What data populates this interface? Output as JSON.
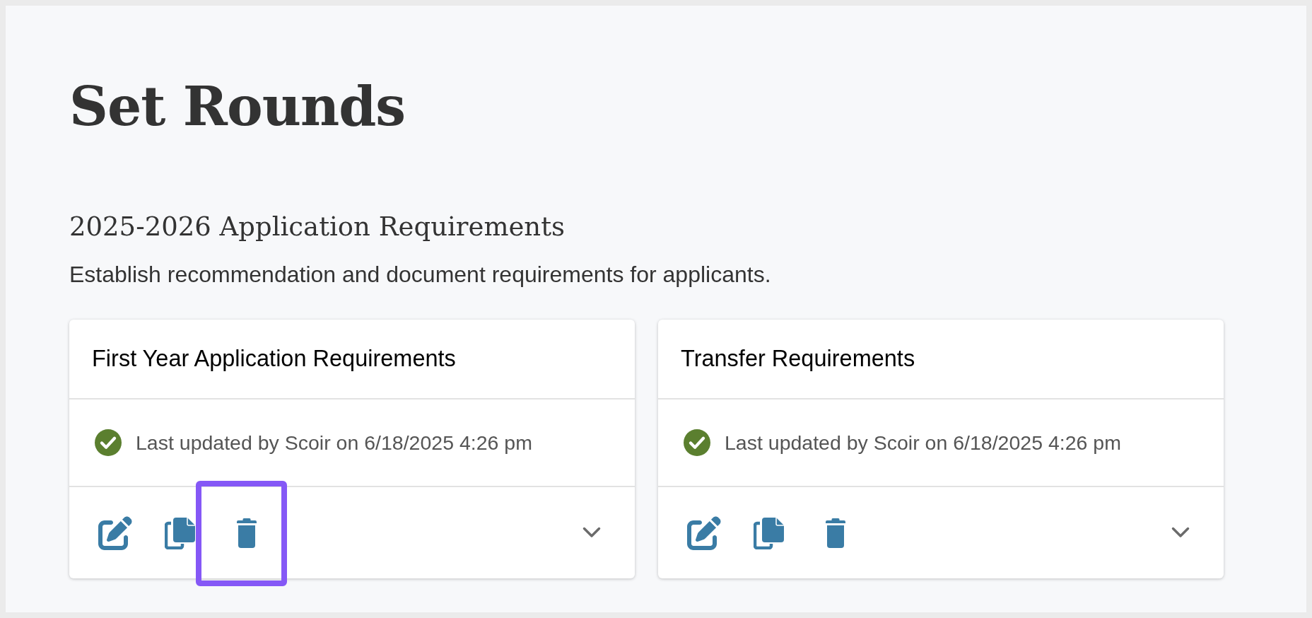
{
  "page": {
    "title": "Set Rounds"
  },
  "section": {
    "title": "2025-2026 Application Requirements",
    "description": "Establish recommendation and document requirements for applicants."
  },
  "cards": [
    {
      "title": "First Year Application Requirements",
      "complete": true,
      "updated": "Last updated by Scoir on 6/18/2025 4:26 pm",
      "expanded": false,
      "actions": [
        {
          "kind": "edit",
          "highlighted": false
        },
        {
          "kind": "copy",
          "highlighted": false
        },
        {
          "kind": "delete",
          "highlighted": true
        }
      ]
    },
    {
      "title": "Transfer Requirements",
      "complete": true,
      "updated": "Last updated by Scoir on 6/18/2025 4:26 pm",
      "expanded": false,
      "actions": [
        {
          "kind": "edit",
          "highlighted": false
        },
        {
          "kind": "copy",
          "highlighted": false
        },
        {
          "kind": "delete",
          "highlighted": false
        }
      ]
    }
  ]
}
